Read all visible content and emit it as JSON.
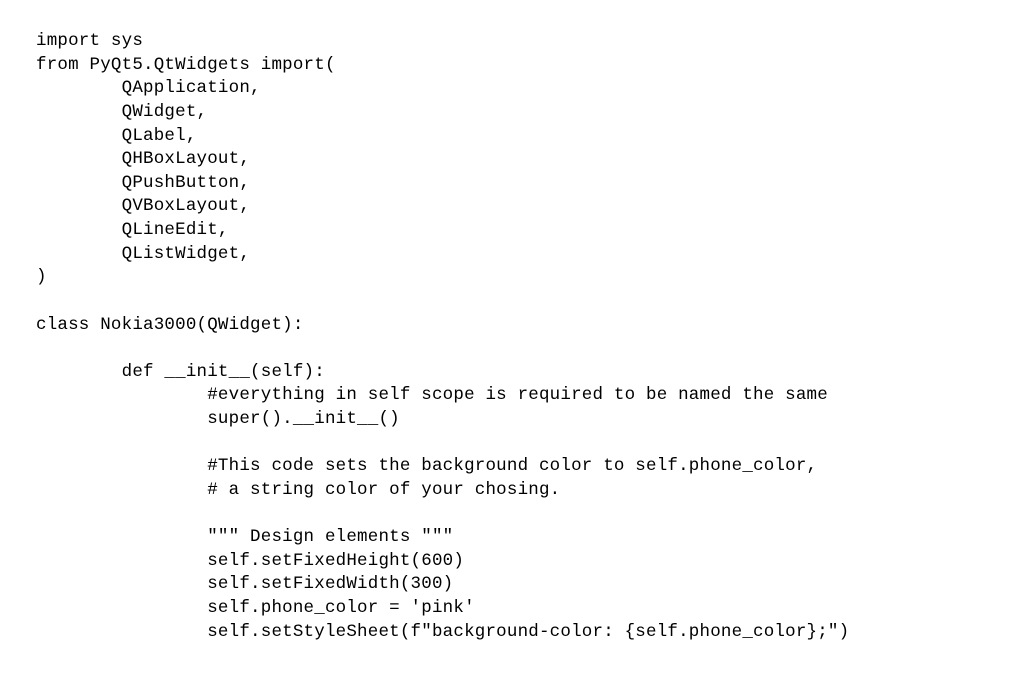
{
  "code": {
    "lines": [
      "import sys",
      "from PyQt5.QtWidgets import(",
      "        QApplication,",
      "        QWidget,",
      "        QLabel,",
      "        QHBoxLayout,",
      "        QPushButton,",
      "        QVBoxLayout,",
      "        QLineEdit,",
      "        QListWidget,",
      ")",
      "",
      "class Nokia3000(QWidget):",
      "",
      "        def __init__(self):",
      "                #everything in self scope is required to be named the same",
      "                super().__init__()",
      "",
      "                #This code sets the background color to self.phone_color,",
      "                # a string color of your chosing.",
      "",
      "                \"\"\" Design elements \"\"\"",
      "                self.setFixedHeight(600)",
      "                self.setFixedWidth(300)",
      "                self.phone_color = 'pink'",
      "                self.setStyleSheet(f\"background-color: {self.phone_color};\")"
    ]
  }
}
